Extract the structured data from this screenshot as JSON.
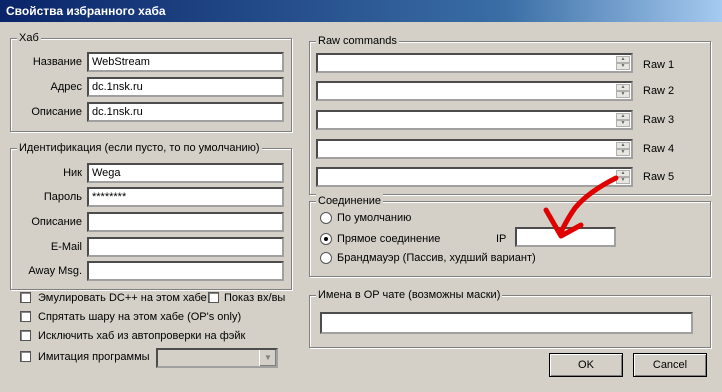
{
  "window": {
    "title": "Свойства избранного хаба"
  },
  "hub": {
    "legend": "Хаб",
    "name_label": "Название",
    "name_value": "WebStream",
    "address_label": "Адрес",
    "address_value": "dc.1nsk.ru",
    "desc_label": "Описание",
    "desc_value": "dc.1nsk.ru"
  },
  "ident": {
    "legend": "Идентификация (если пусто, то по умолчанию)",
    "nick_label": "Ник",
    "nick_value": "Wega",
    "password_label": "Пароль",
    "password_value": "********",
    "desc_label": "Описание",
    "desc_value": "",
    "email_label": "E-Mail",
    "email_value": "",
    "away_label": "Away Msg.",
    "away_value": ""
  },
  "options": {
    "emulate_dc": "Эмулировать DC++ на этом хабе",
    "show_io": "Показ вх/вы",
    "hide_share": "Спрятать шару на этом хабе (OP's only)",
    "exclude_fake": "Исключить хаб из автопроверки на фэйк",
    "client_imitation": "Имитация программы",
    "client_value": ""
  },
  "raw": {
    "legend": "Raw commands",
    "labels": [
      "Raw 1",
      "Raw 2",
      "Raw 3",
      "Raw 4",
      "Raw 5"
    ]
  },
  "connection": {
    "legend": "Соединение",
    "default": "По умолчанию",
    "direct": "Прямое соединение",
    "firewall": "Брандмауэр (Пассив, худший вариант)",
    "ip_label": "IP",
    "ip_value": "",
    "selected": "direct"
  },
  "opchat": {
    "legend": "Имена в OP чате (возможны маски)",
    "value": ""
  },
  "buttons": {
    "ok": "OK",
    "cancel": "Cancel"
  },
  "colors": {
    "title_bar": "#0a246a",
    "dialog_bg": "#d4d0c8",
    "annotation_arrow": "#e00000"
  }
}
